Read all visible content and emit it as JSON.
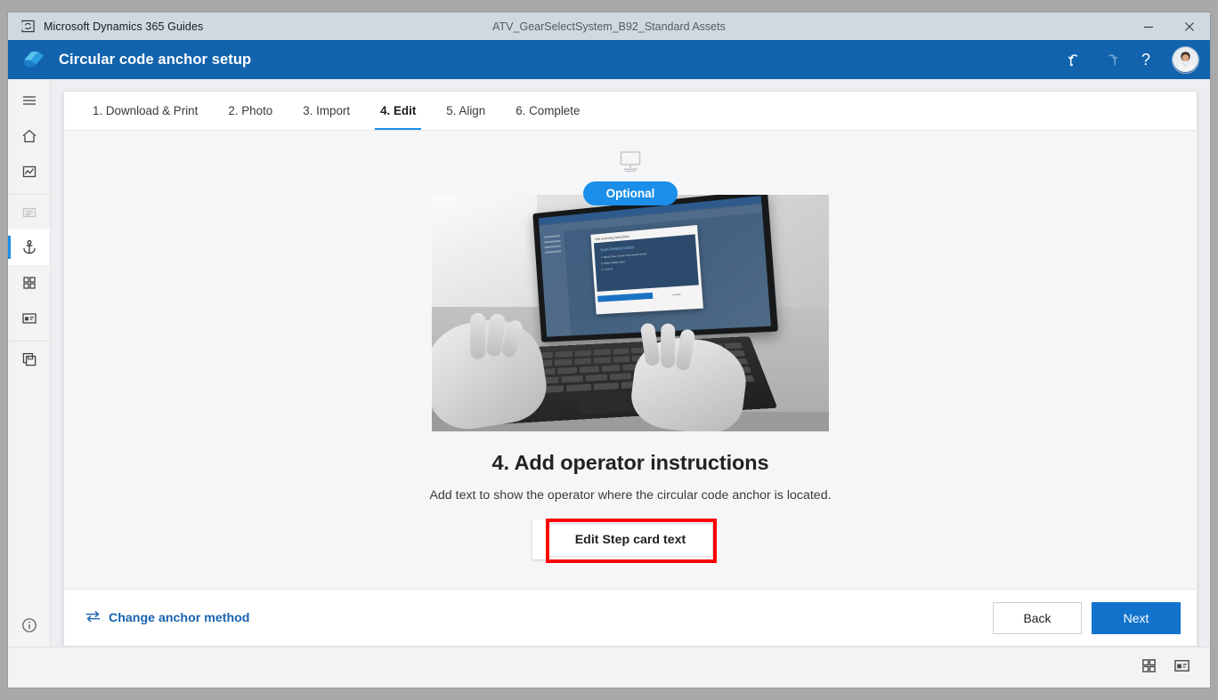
{
  "window": {
    "app_icon": "dynamics-guides-app-icon",
    "app_name": "Microsoft Dynamics 365 Guides",
    "document_title": "ATV_GearSelectSystem_B92_Standard Assets",
    "minimize_label": "—",
    "close_label": "✕"
  },
  "appbar": {
    "logo": "guides-logo",
    "title": "Circular code anchor setup",
    "undo_icon": "undo-icon",
    "redo_icon": "redo-icon",
    "help_icon": "help-icon",
    "help_label": "?",
    "avatar": "user-avatar"
  },
  "rail": {
    "items": [
      {
        "icon": "hamburger-menu-icon",
        "name": "menu",
        "state": "normal"
      },
      {
        "icon": "home-icon",
        "name": "home",
        "state": "normal"
      },
      {
        "icon": "analytics-icon",
        "name": "analytics",
        "state": "normal"
      },
      {
        "icon": "outline-icon",
        "name": "outline",
        "state": "dim"
      },
      {
        "icon": "anchor-icon",
        "name": "anchor",
        "state": "selected"
      },
      {
        "icon": "grid-icon",
        "name": "steps",
        "state": "normal"
      },
      {
        "icon": "media-card-icon",
        "name": "media",
        "state": "normal"
      },
      {
        "icon": "copy-icon",
        "name": "copy",
        "state": "normal"
      }
    ],
    "info_icon": "info-icon"
  },
  "tabs": [
    {
      "label": "1. Download & Print",
      "active": false
    },
    {
      "label": "2. Photo",
      "active": false
    },
    {
      "label": "3. Import",
      "active": false
    },
    {
      "label": "4. Edit",
      "active": true
    },
    {
      "label": "5. Align",
      "active": false
    },
    {
      "label": "6. Complete",
      "active": false
    }
  ],
  "stage": {
    "monitor_icon": "desktop-monitor-icon",
    "badge": "Optional",
    "illustration": {
      "alt": "person typing on a laptop showing the anchoring instructions dialog",
      "screen": {
        "dialog_title": "Edit anchoring instructions",
        "heading": "Scan Printed Anchor",
        "steps": [
          "1. Stand 2 feet in front of the printed anchor",
          "2. Select 'Initiate Scan'",
          "3. Look up"
        ],
        "primary_button": "Next",
        "cancel_button": "Cancel"
      }
    },
    "heading": "4. Add operator instructions",
    "subheading": "Add text to show the operator where the circular code anchor is located.",
    "cta_button": "Edit Step card text",
    "highlight_color": "#ff0000"
  },
  "footer": {
    "change_icon": "swap-arrows-icon",
    "change_label": "Change anchor method",
    "back_label": "Back",
    "next_label": "Next"
  },
  "statusbar": {
    "grid_icon": "grid-view-icon",
    "card_icon": "card-view-icon"
  },
  "colors": {
    "brand_blue": "#1263ad",
    "accent_blue": "#1a8ee8",
    "primary_button": "#1273cd",
    "highlight_red": "#ff0000"
  }
}
